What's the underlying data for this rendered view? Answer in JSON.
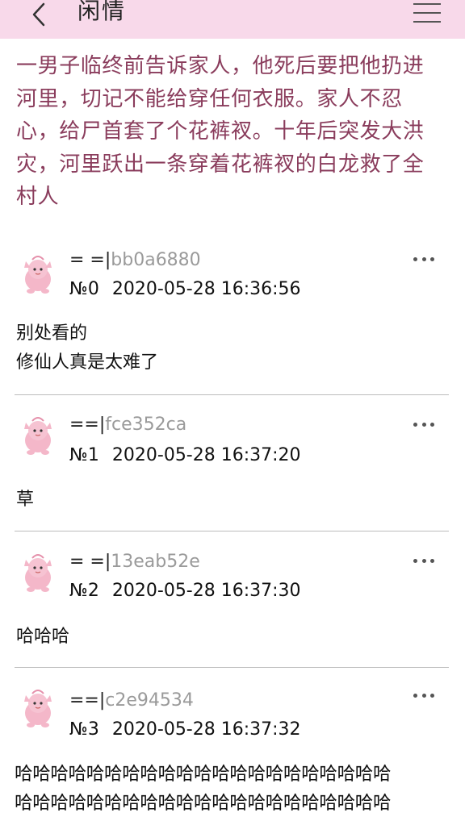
{
  "header": {
    "title": "闲情",
    "back_icon": "chevron-left-icon",
    "menu_icon": "hamburger-menu-icon",
    "background": "#f8d9ea"
  },
  "post": {
    "text": "一男子临终前告诉家人，他死后要把他扔进河里，切记不能给穿任何衣服。家人不忍心，给尸首套了个花裤衩。十年后突发大洪灾，河里跃出一条穿着花裤衩的白龙救了全村人",
    "color": "#8a3c5c"
  },
  "replies": [
    {
      "prefix": "= =|",
      "uid": "bb0a6880",
      "num": "№0",
      "time": "2020-05-28 16:36:56",
      "lines": [
        "别处看的",
        "修仙人真是太难了"
      ]
    },
    {
      "prefix": "==|",
      "uid": "fce352ca",
      "num": "№1",
      "time": "2020-05-28 16:37:20",
      "lines": [
        "草"
      ]
    },
    {
      "prefix": "= =|",
      "uid": "13eab52e",
      "num": "№2",
      "time": "2020-05-28 16:37:30",
      "lines": [
        "哈哈哈"
      ]
    },
    {
      "prefix": "==|",
      "uid": "c2e94534",
      "num": "№3",
      "time": "2020-05-28 16:37:32",
      "lines": [
        "哈哈哈哈哈哈哈哈哈哈哈哈哈哈哈哈哈哈哈哈哈",
        "哈哈哈哈哈哈哈哈哈哈哈哈哈哈哈哈哈哈哈哈哈"
      ]
    }
  ],
  "more_icon": "more-horizontal-icon",
  "avatar_icon": "pink-creature-avatar"
}
